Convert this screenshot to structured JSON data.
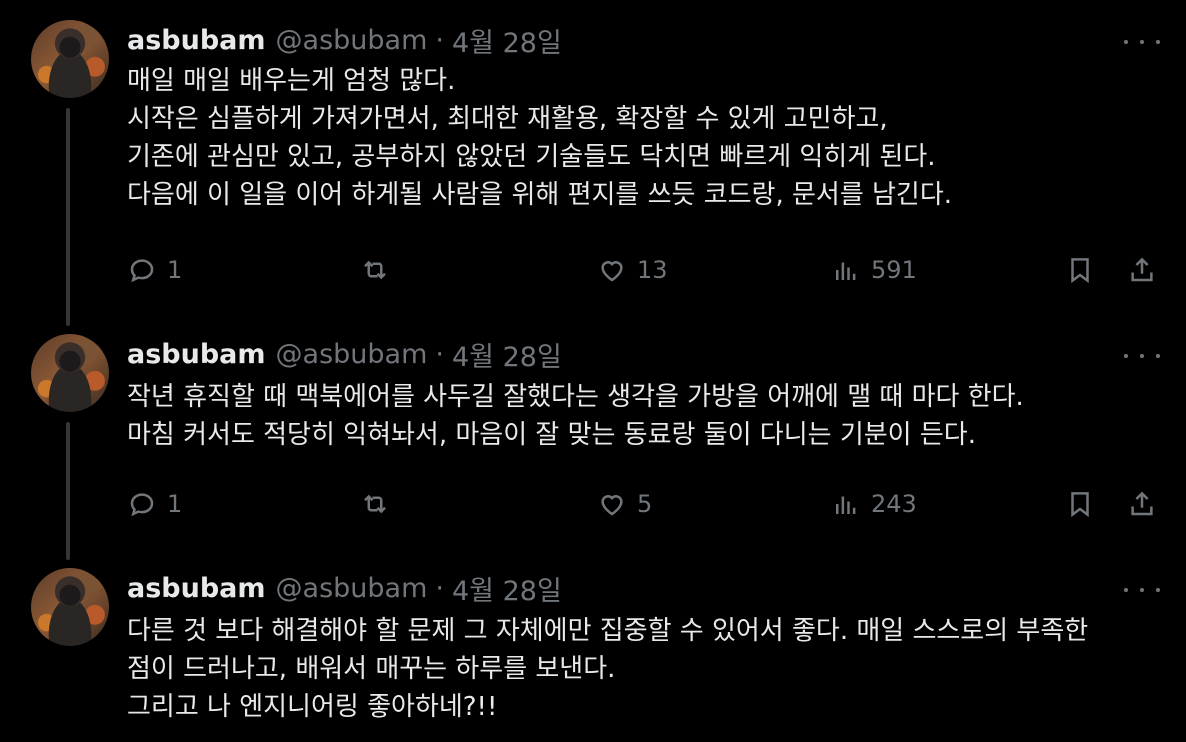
{
  "tweets": [
    {
      "name": "asbubam",
      "handle": "@asbubam",
      "separator": "·",
      "date": "4월 28일",
      "lines": [
        "매일 매일 배우는게 엄청 많다.",
        "시작은 심플하게 가져가면서, 최대한 재활용, 확장할 수 있게 고민하고,",
        "기존에 관심만 있고, 공부하지 않았던 기술들도 닥치면 빠르게 익히게 된다.",
        "다음에 이 일을 이어 하게될 사람을 위해 편지를 쓰듯 코드랑, 문서를 남긴다."
      ],
      "replies": "1",
      "retweets": "",
      "likes": "13",
      "views": "591"
    },
    {
      "name": "asbubam",
      "handle": "@asbubam",
      "separator": "·",
      "date": "4월 28일",
      "lines": [
        "작년 휴직할 때 맥북에어를 사두길 잘했다는 생각을 가방을 어깨에 맬 때 마다 한다.",
        "마침 커서도 적당히 익혀놔서, 마음이 잘 맞는 동료랑 둘이 다니는 기분이 든다."
      ],
      "replies": "1",
      "retweets": "",
      "likes": "5",
      "views": "243"
    },
    {
      "name": "asbubam",
      "handle": "@asbubam",
      "separator": "·",
      "date": "4월 28일",
      "lines": [
        "다른 것 보다 해결해야 할 문제 그 자체에만 집중할 수 있어서 좋다. 매일 스스로의 부족한",
        "점이 드러나고, 배워서 매꾸는 하루를 보낸다.",
        "그리고 나 엔지니어링 좋아하네?!!"
      ]
    }
  ],
  "icons": {
    "reply": "reply-icon",
    "retweet": "retweet-icon",
    "like": "heart-icon",
    "views": "views-icon",
    "bookmark": "bookmark-icon",
    "share": "share-icon",
    "more": "more-icon"
  },
  "colors": {
    "background": "#000000",
    "text": "#e7e9ea",
    "secondary": "#71767b",
    "thread_line": "#333639"
  }
}
